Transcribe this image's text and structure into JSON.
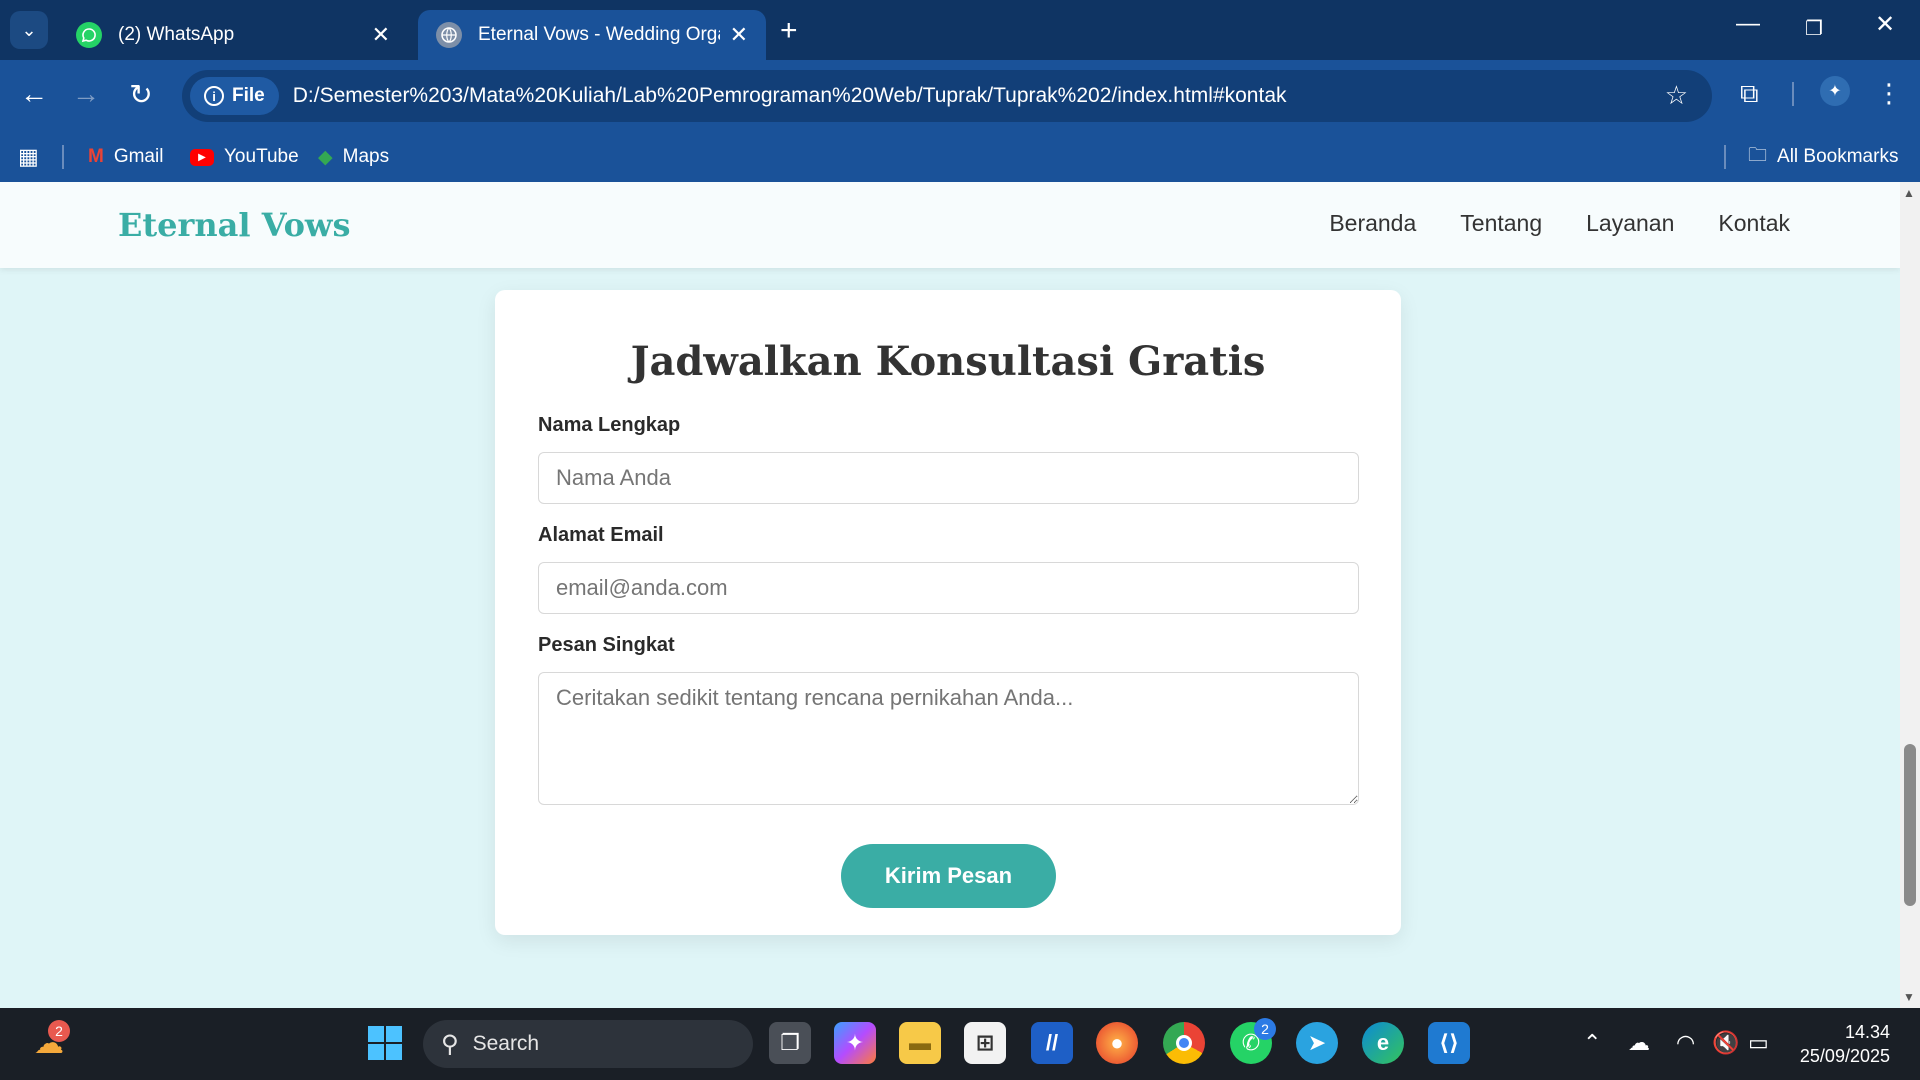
{
  "browser": {
    "tabs": [
      {
        "title": "(2) WhatsApp",
        "icon": "whatsapp-icon",
        "active": false
      },
      {
        "title": "Eternal Vows - Wedding Organi",
        "icon": "globe-icon",
        "active": true
      }
    ],
    "address": {
      "scheme_label": "File",
      "url": "D:/Semester%203/Mata%20Kuliah/Lab%20Pemrograman%20Web/Tuprak/Tuprak%202/index.html#kontak"
    },
    "bookmarks": [
      {
        "label": "Gmail",
        "icon": "gmail-icon"
      },
      {
        "label": "YouTube",
        "icon": "youtube-icon"
      },
      {
        "label": "Maps",
        "icon": "maps-icon"
      }
    ],
    "all_bookmarks_label": "All Bookmarks"
  },
  "site": {
    "brand": "Eternal Vows",
    "nav": [
      "Beranda",
      "Tentang",
      "Layanan",
      "Kontak"
    ],
    "accent_color": "#3aada5"
  },
  "form": {
    "title": "Jadwalkan Konsultasi Gratis",
    "name_label": "Nama Lengkap",
    "name_placeholder": "Nama Anda",
    "email_label": "Alamat Email",
    "email_placeholder": "email@anda.com",
    "message_label": "Pesan Singkat",
    "message_placeholder": "Ceritakan sedikit tentang rencana pernikahan Anda...",
    "submit_label": "Kirim Pesan"
  },
  "taskbar": {
    "search_label": "Search",
    "weather_badge": "2",
    "whatsapp_badge": "2",
    "time": "14.34",
    "date": "25/09/2025"
  }
}
